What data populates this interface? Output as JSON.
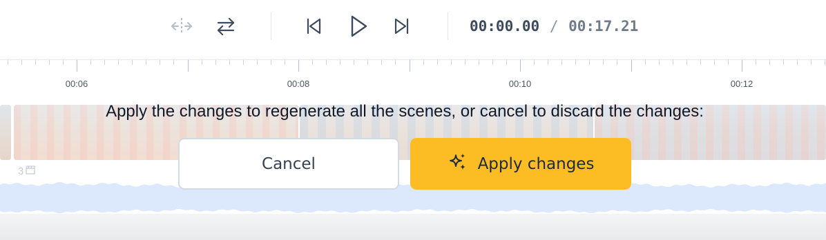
{
  "player": {
    "time_current": "00:00.00",
    "time_separator": "/",
    "time_total": "00:17.21",
    "controls": [
      {
        "name": "split-clip-icon",
        "enabled": false
      },
      {
        "name": "swap-icon",
        "enabled": true
      },
      {
        "name": "skip-previous-icon",
        "enabled": true
      },
      {
        "name": "play-icon",
        "enabled": true
      },
      {
        "name": "skip-next-icon",
        "enabled": true
      }
    ]
  },
  "ruler": {
    "labels": [
      "00:06",
      "00:08",
      "00:10",
      "00:12"
    ]
  },
  "timeline": {
    "scene_count": "3"
  },
  "dialog": {
    "message": "Apply the changes to regenerate all the scenes, or cancel to discard the changes:",
    "cancel_label": "Cancel",
    "apply_label": "Apply changes"
  },
  "colors": {
    "accent": "#fbbd23",
    "text_primary": "#111827",
    "audio_wave": "#dce8fb"
  }
}
